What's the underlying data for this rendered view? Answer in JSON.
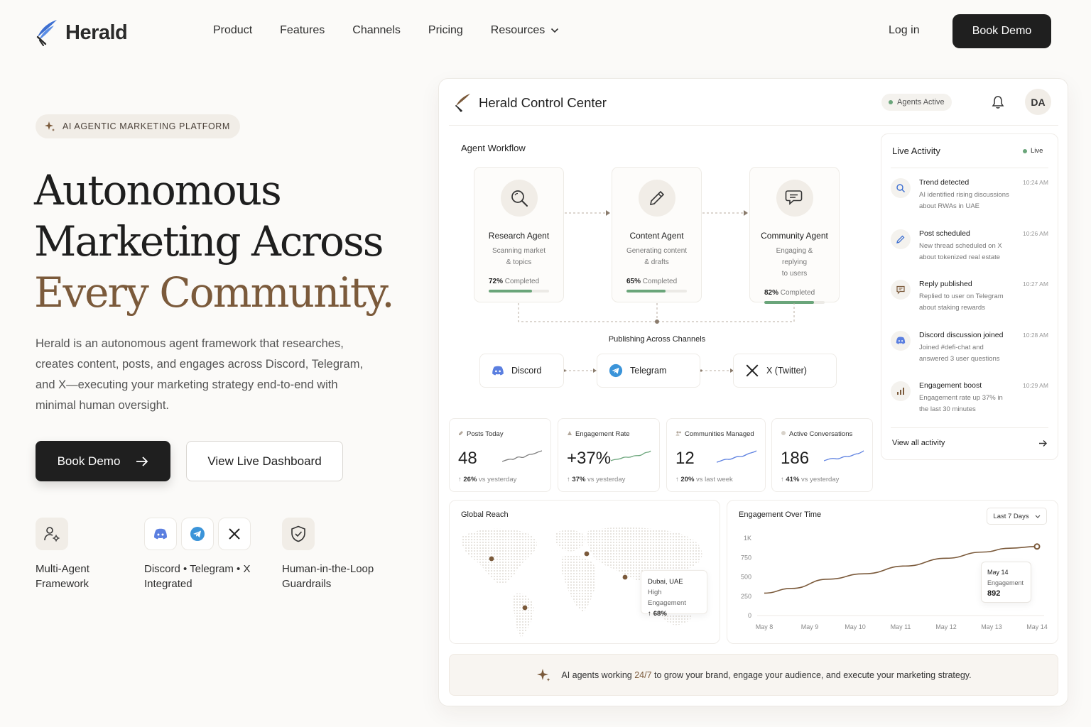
{
  "brand": {
    "name": "Herald"
  },
  "nav": {
    "items": [
      "Product",
      "Features",
      "Channels",
      "Pricing"
    ],
    "resources": "Resources",
    "login": "Log in",
    "cta": "Book Demo"
  },
  "hero": {
    "badge": "AI AGENTIC MARKETING PLATFORM",
    "title_line1": "Autonomous",
    "title_line2": "Marketing Across",
    "title_line3": "Every Community.",
    "description": "Herald is an autonomous agent framework that researches, creates content, posts, and engages across Discord, Telegram, and X—executing your marketing strategy end-to-end with minimal human oversight.",
    "primary_cta": "Book Demo",
    "secondary_cta": "View Live Dashboard",
    "features": [
      {
        "line1": "Multi-Agent",
        "line2": "Framework",
        "icon": "user-gear-icon"
      },
      {
        "line1": "Discord • Telegram • X",
        "line2": "Integrated",
        "icon": "channels-icon"
      },
      {
        "line1": "Human-in-the-Loop",
        "line2": "Guardrails",
        "icon": "shield-check-icon"
      }
    ]
  },
  "dashboard": {
    "title": "Herald Control Center",
    "status": "Agents Active",
    "avatar": "DA",
    "workflow": {
      "title": "Agent Workflow",
      "agents": [
        {
          "name": "Research Agent",
          "desc1": "Scanning market",
          "desc2": "& topics",
          "progress": "72%",
          "progress_label": "Completed",
          "progress_value": 0.72,
          "icon": "search-icon"
        },
        {
          "name": "Content Agent",
          "desc1": "Generating content",
          "desc2": "& drafts",
          "progress": "65%",
          "progress_label": "Completed",
          "progress_value": 0.65,
          "icon": "pencil-icon"
        },
        {
          "name": "Community Agent",
          "desc1": "Engaging & replying",
          "desc2": "to users",
          "progress": "82%",
          "progress_label": "Completed",
          "progress_value": 0.82,
          "icon": "chat-icon"
        }
      ],
      "publishing_label": "Publishing Across Channels",
      "channels": [
        "Discord",
        "Telegram",
        "X (Twitter)"
      ]
    },
    "live": {
      "title": "Live Activity",
      "badge": "Live",
      "items": [
        {
          "title": "Trend detected",
          "desc1": "AI identified rising discussions",
          "desc2": "about RWAs in UAE",
          "time": "10:24 AM",
          "icon": "search-icon"
        },
        {
          "title": "Post scheduled",
          "desc1": "New thread scheduled on X",
          "desc2": "about tokenized real estate",
          "time": "10:26 AM",
          "icon": "pencil-icon"
        },
        {
          "title": "Reply published",
          "desc1": "Replied to user on Telegram",
          "desc2": "about staking rewards",
          "time": "10:27 AM",
          "icon": "chat-icon"
        },
        {
          "title": "Discord discussion joined",
          "desc1": "Joined #defi-chat and",
          "desc2": "answered 3 user questions",
          "time": "10:28 AM",
          "icon": "discord-icon"
        },
        {
          "title": "Engagement boost",
          "desc1": "Engagement rate up 37% in",
          "desc2": "the last 30 minutes",
          "time": "10:29 AM",
          "icon": "bar-chart-icon"
        }
      ],
      "view_all": "View all activity"
    },
    "stats": [
      {
        "label": "Posts Today",
        "value": "48",
        "change": "26%",
        "suffix": "vs yesterday"
      },
      {
        "label": "Engagement Rate",
        "value": "+37%",
        "change": "37%",
        "suffix": "vs yesterday"
      },
      {
        "label": "Communities Managed",
        "value": "12",
        "change": "20%",
        "suffix": "vs last week"
      },
      {
        "label": "Active Conversations",
        "value": "186",
        "change": "41%",
        "suffix": "vs yesterday"
      }
    ],
    "reach": {
      "title": "Global Reach",
      "tooltip_city": "Dubai, UAE",
      "tooltip_label": "High Engagement",
      "tooltip_value": "68%"
    },
    "engagement": {
      "title": "Engagement Over Time",
      "range": "Last 7 Days",
      "tooltip_date": "May 14",
      "tooltip_label": "Engagement",
      "tooltip_value": "892"
    },
    "banner": {
      "pre": "AI agents working ",
      "highlight": "24/7",
      "post": " to grow your brand, engage your audience, and execute your marketing strategy."
    }
  },
  "chart_data": {
    "type": "line",
    "title": "Engagement Over Time",
    "x": [
      "May 8",
      "May 9",
      "May 10",
      "May 11",
      "May 12",
      "May 13",
      "May 14"
    ],
    "y_ticks": [
      "1K",
      "750",
      "500",
      "250",
      "0"
    ],
    "ylim": [
      0,
      1000
    ],
    "series": [
      {
        "values": [
          290,
          350,
          470,
          540,
          640,
          740,
          820,
          870,
          892
        ]
      }
    ],
    "x_positions": [
      8,
      8.6,
      9.4,
      10.2,
      11.1,
      12.0,
      12.8,
      13.4,
      14
    ]
  }
}
